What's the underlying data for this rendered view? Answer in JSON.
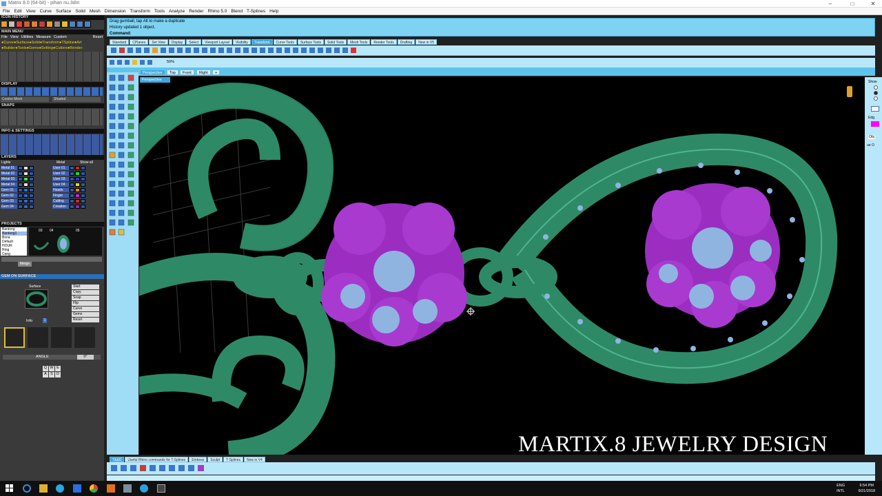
{
  "window": {
    "title": "Matrix 8.0 (64-bit) - pihan nu.3dm",
    "minimize": "–",
    "maximize": "□",
    "close": "✕"
  },
  "menu": [
    "File",
    "Edit",
    "View",
    "Curve",
    "Surface",
    "Solid",
    "Mesh",
    "Dimension",
    "Transform",
    "Tools",
    "Analyze",
    "Render",
    "Rhino 5.0",
    "Blend",
    "T-Splines",
    "Help"
  ],
  "left": {
    "icon_history": "ICON HISTORY",
    "main_menu": "MAIN MENU",
    "main_menu_items": [
      "File",
      "View",
      "Utilities",
      "Measure",
      "Custom",
      "Reset"
    ],
    "main_sub1": "●Curve●Surface●Solid●Transform●TSpline●Art",
    "main_sub2": "●Builder●Tools●Gems●Setting●Cutters●Render",
    "display": "DISPLAY",
    "display_mode1": "Cosmo Mesh",
    "display_mode2": "Shaded",
    "snaps": "SNAPS",
    "info_settings": "INFO & SETTINGS",
    "layers": "LAYERS",
    "layers_header": {
      "lights": "Lights",
      "metal": "Metal",
      "show": "Show all"
    },
    "layers_left": [
      {
        "name": "Metal 01",
        "color": "#e6e6e6"
      },
      {
        "name": "Metal 02",
        "color": "#e6e6e6"
      },
      {
        "name": "Metal 03",
        "color": "#4bdc4b"
      },
      {
        "name": "Metal 04",
        "color": "#e6e6e6"
      },
      {
        "name": "Gem 01",
        "color": "#2a6ee0"
      },
      {
        "name": "Gem 02",
        "color": "#2a6ee0"
      },
      {
        "name": "Gem 03",
        "color": "#2a6ee0"
      },
      {
        "name": "Gem 04",
        "color": "#2a6ee0"
      }
    ],
    "layers_right": [
      {
        "name": "User 01",
        "color": "#e01f1f"
      },
      {
        "name": "User 02",
        "color": "#1fe01f"
      },
      {
        "name": "User 03",
        "color": "#1f3fe0"
      },
      {
        "name": "User 04",
        "color": "#e0e01f"
      },
      {
        "name": "Heads",
        "color": "#e0862a"
      },
      {
        "name": "Finger",
        "color": "#c02ad0"
      },
      {
        "name": "Cutting",
        "color": "#e01f1f"
      },
      {
        "name": "Creation",
        "color": "#8a2ad0"
      }
    ],
    "projects": "PROJECTS",
    "project_list": [
      "Bantong",
      "Bantong1",
      "Bona",
      "Default",
      "HOUR",
      "Ring",
      "Cang"
    ],
    "project_nums": [
      "03",
      "04",
      "05"
    ],
    "project_merge": "Merge",
    "gem_on_surface": "GEM ON SURFACE",
    "gos_label": "Surface",
    "gos_buttons": [
      "Start",
      "Copy",
      "Snap",
      "Flip",
      "Curve",
      "Gems",
      "Reset"
    ],
    "gos_info": "Info",
    "gos_info_val": "1",
    "angle_label": "ANGLE",
    "angle_value": "0°",
    "keys_row1": [
      "Q",
      "W",
      "E"
    ],
    "keys_row2": [
      "A",
      "S",
      "D"
    ]
  },
  "command": {
    "line1": "Drag gumball, tap Alt to make a duplicate",
    "line2": "History updated 1 object.",
    "prompt": "Command:"
  },
  "toolbar_tabs": [
    "Standard",
    "CPlanes",
    "Set View",
    "Display",
    "Select",
    "Viewport Layout",
    "Visibility",
    "Transform",
    "Curve Tools",
    "Surface Tools",
    "Solid Tools",
    "Mesh Tools",
    "Render Tools",
    "Drafting",
    "New in V5"
  ],
  "toolbar_active": "Transform",
  "zoom": "50%",
  "viewport_tabs": [
    "Perspective",
    "Top",
    "Front",
    "Right"
  ],
  "viewport_active": "Perspective",
  "viewport_label": "Perspective",
  "watermark": "MARTIX.8 JEWELRY DESIGN",
  "right_panel": {
    "show": "Show",
    "edg": "Edg.",
    "obj": "Obj",
    "ue": "ue O"
  },
  "bottom_tabs": [
    "T&&D",
    "Useful Rhino commands for T-Splines",
    "Emboss",
    "Sculpt",
    "T-Splines",
    "New in V4"
  ],
  "taskbar": {
    "lang1": "ENG",
    "lang2": "INTL",
    "time": "6:54 PM",
    "date": "9/21/2018"
  },
  "colors": {
    "accent": "#7ed3f2",
    "metal": "#2e8a66",
    "gem_setting": "#9b2ec0",
    "gem": "#8fb4e0"
  }
}
